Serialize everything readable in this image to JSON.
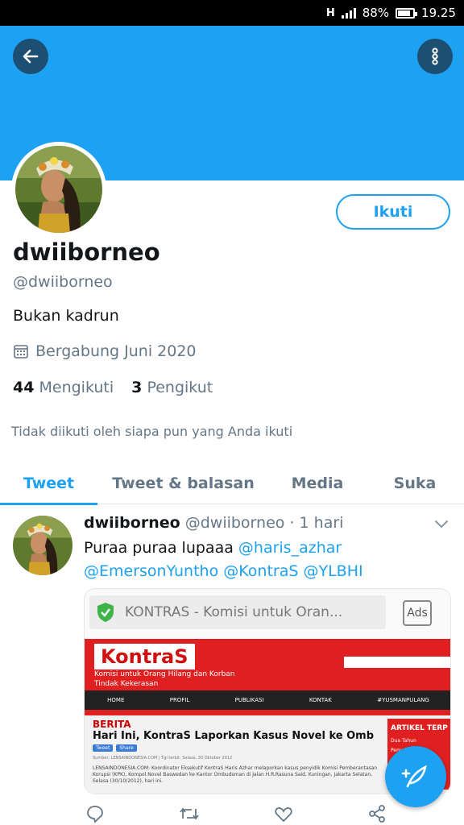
{
  "status_bar": {
    "network": "H",
    "battery": "88%",
    "time": "19.25"
  },
  "profile": {
    "display_name": "dwiiborneo",
    "handle": "@dwiiborneo",
    "bio": "Bukan kadrun",
    "joined": "Bergabung Juni 2020",
    "following_count": "44",
    "following_label": "Mengikuti",
    "followers_count": "3",
    "followers_label": "Pengikut",
    "not_followed_note": "Tidak diikuti oleh siapa pun yang Anda ikuti",
    "follow_button": "Ikuti"
  },
  "tabs": [
    {
      "label": "Tweet",
      "active": true
    },
    {
      "label": "Tweet & balasan",
      "active": false
    },
    {
      "label": "Media",
      "active": false
    },
    {
      "label": "Suka",
      "active": false
    }
  ],
  "tweet": {
    "name": "dwiiborneo",
    "handle": "@dwiiborneo",
    "separator": "·",
    "time": "1 hari",
    "text": "Puraa puraa lupaaa",
    "mentions": [
      "@haris_azhar",
      "@EmersonYuntho",
      "@KontraS",
      "@YLBHI"
    ],
    "card": {
      "url_text": "KONTRAS - Komisi untuk Oran...",
      "ads_label": "Ads",
      "logo": "KontraS",
      "tagline": "Komisi untuk Orang Hilang dan Korban Tindak Kekerasan",
      "nav": [
        "HOME",
        "PROFIL",
        "PUBLIKASI",
        "KONTAK",
        "#YUSMANPULANG"
      ],
      "section": "BERITA",
      "headline": "Hari Ini, KontraS Laporkan Kasus Novel ke Ombudsman",
      "share_buttons": [
        "Tweet",
        "Share"
      ],
      "meta": "Sumber: LENSAINDONESIA.COM | Tgl terbit: Selasa, 30 Oktober 2012",
      "body": "LENSAINDONESIA.COM: Koordinator Eksekutif KontraS Haris Azhar melaporkan kasus penyidik Komisi Pemberantasan Korupsi (KPK), Kompol Novel Baswedan ke Kantor Ombudsman di Jalan H.R.Rasuna Said, Kuningan, Jakarta Selatan, Selasa (30/10/2012), hari ini.",
      "side_title": "ARTIKEL TERP",
      "side_text": "Dua Tahun Pemerintahan..."
    }
  },
  "colors": {
    "accent": "#1da1f2",
    "banner": "#1da1f2",
    "text": "#14171a",
    "muted": "#657786"
  },
  "icons": {
    "back": "arrow-left-icon",
    "more": "more-vertical-icon",
    "calendar": "calendar-icon",
    "chevron": "chevron-down-icon",
    "reply": "reply-icon",
    "retweet": "retweet-icon",
    "like": "heart-icon",
    "share": "share-icon",
    "compose": "compose-icon"
  }
}
